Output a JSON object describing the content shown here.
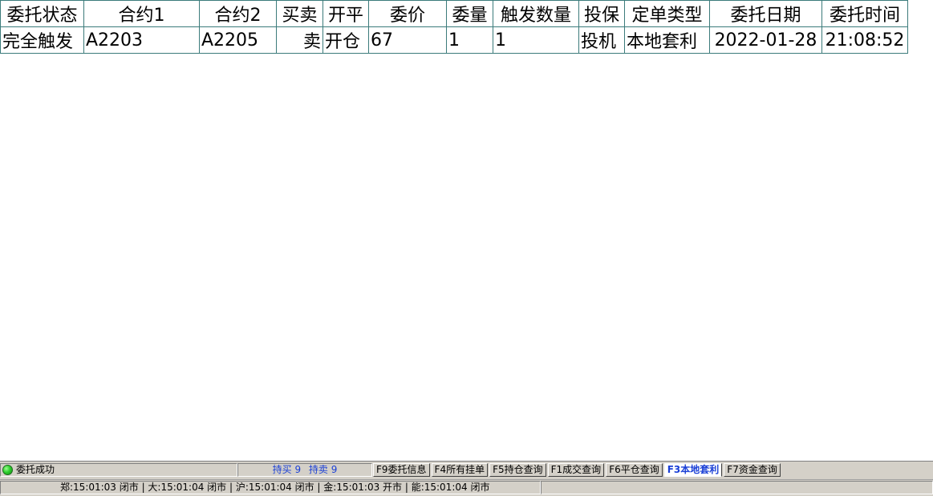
{
  "table": {
    "headers": [
      "委托状态",
      "合约1",
      "合约2",
      "买卖",
      "开平",
      "委价",
      "委量",
      "触发数量",
      "投保",
      "定单类型",
      "委托日期",
      "委托时间"
    ],
    "rows": [
      [
        "完全触发",
        "A2203",
        "A2205",
        "卖",
        "开仓",
        "67",
        "1",
        "1",
        "投机",
        "本地套利",
        "2022-01-28",
        "21:08:52"
      ]
    ]
  },
  "statusbar": {
    "message": "委托成功",
    "position": {
      "long_label": "持买 9",
      "short_label": "持卖 9"
    },
    "tabs": [
      "F9委托信息",
      "F4所有挂单",
      "F5持仓查询",
      "F1成交查询",
      "F6平仓查询",
      "F3本地套利",
      "F7资金查询"
    ],
    "active_tab": "F3本地套利",
    "exchange_status": "郑:15:01:03 闭市 | 大:15:01:04 闭市 | 沪:15:01:04 闭市 | 金:15:01:03 开市 | 能:15:01:04 闭市"
  },
  "colors": {
    "grid_border": "#3c7b7b",
    "status_bg": "#d4d0c8",
    "accent_blue": "#1a3fd6",
    "led_green": "#2fcf2f"
  },
  "icons": {
    "status_led": "green-circle-icon"
  }
}
